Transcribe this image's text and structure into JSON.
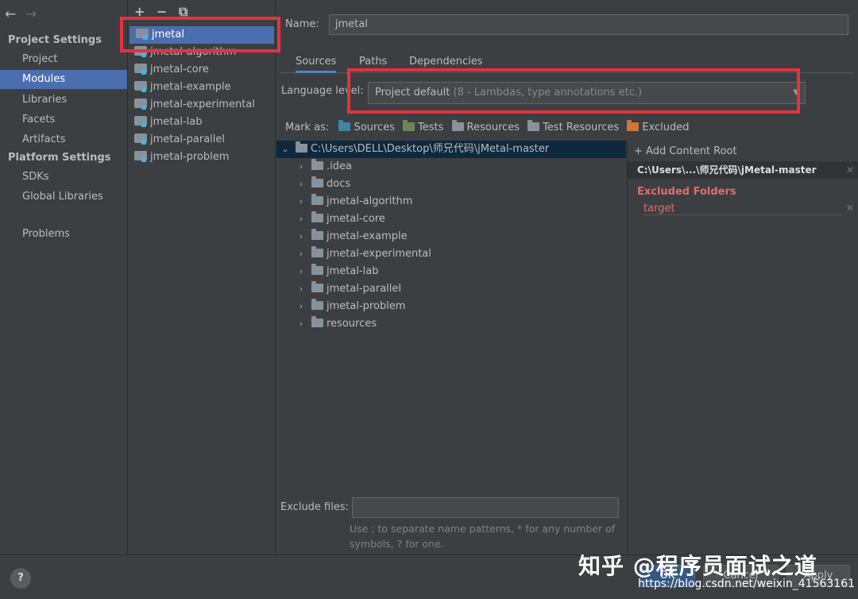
{
  "nav": {
    "back": "←",
    "forward": "→",
    "project_settings": "Project Settings",
    "project_items": [
      "Project",
      "Modules",
      "Libraries",
      "Facets",
      "Artifacts"
    ],
    "platform_settings": "Platform Settings",
    "platform_items": [
      "SDKs",
      "Global Libraries"
    ],
    "problems": "Problems"
  },
  "modules": {
    "add": "+",
    "remove": "−",
    "copy": "⧉",
    "items": [
      "jmetal",
      "jmetal-algorithm",
      "jmetal-core",
      "jmetal-example",
      "jmetal-experimental",
      "jmetal-lab",
      "jmetal-parallel",
      "jmetal-problem"
    ]
  },
  "main": {
    "name_label": "Name:",
    "name_value": "jmetal",
    "tabs": [
      "Sources",
      "Paths",
      "Dependencies"
    ],
    "language_label": "Language level:",
    "language_value": "Project default",
    "language_detail": "(8 - Lambdas, type annotations etc.)",
    "mark_as_label": "Mark as:",
    "mark_as": [
      {
        "label": "Sources",
        "color": "#3e86a0"
      },
      {
        "label": "Tests",
        "color": "#6a8759"
      },
      {
        "label": "Resources",
        "color": "#87939a"
      },
      {
        "label": "Test Resources",
        "color": "#87939a"
      },
      {
        "label": "Excluded",
        "color": "#cc7832"
      }
    ],
    "tree_root": "C:\\Users\\DELL\\Desktop\\师兄代码\\jMetal-master",
    "tree_items": [
      ".idea",
      "docs",
      "jmetal-algorithm",
      "jmetal-core",
      "jmetal-example",
      "jmetal-experimental",
      "jmetal-lab",
      "jmetal-parallel",
      "jmetal-problem",
      "resources"
    ],
    "add_content_root": "+ Add Content Root",
    "content_root_path": "C:\\Users\\...\\师兄代码\\jMetal-master",
    "excluded_header": "Excluded Folders",
    "excluded_items": [
      "target"
    ],
    "exclude_files_label": "Exclude files:",
    "exclude_files_hint": "Use ; to separate name patterns, * for any number of symbols, ? for one."
  },
  "footer": {
    "help": "?",
    "ok": "OK",
    "cancel": "Cancel",
    "apply": "Apply",
    "watermark": "知乎 @程序员面试之道",
    "watermark_url": "https://blog.csdn.net/weixin_41563161"
  },
  "colors": {
    "selection": "#4b6eaf",
    "highlight_box": "#e8313a",
    "excluded": "#e06c6c"
  }
}
